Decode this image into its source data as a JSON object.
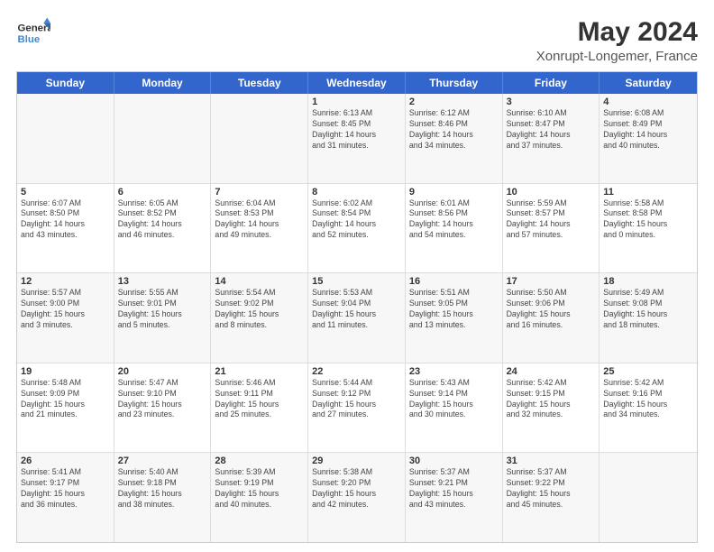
{
  "header": {
    "logo_line1": "General",
    "logo_line2": "Blue",
    "main_title": "May 2024",
    "subtitle": "Xonrupt-Longemer, France"
  },
  "days_of_week": [
    "Sunday",
    "Monday",
    "Tuesday",
    "Wednesday",
    "Thursday",
    "Friday",
    "Saturday"
  ],
  "weeks": [
    [
      {
        "day": "",
        "info": ""
      },
      {
        "day": "",
        "info": ""
      },
      {
        "day": "",
        "info": ""
      },
      {
        "day": "1",
        "info": "Sunrise: 6:13 AM\nSunset: 8:45 PM\nDaylight: 14 hours\nand 31 minutes."
      },
      {
        "day": "2",
        "info": "Sunrise: 6:12 AM\nSunset: 8:46 PM\nDaylight: 14 hours\nand 34 minutes."
      },
      {
        "day": "3",
        "info": "Sunrise: 6:10 AM\nSunset: 8:47 PM\nDaylight: 14 hours\nand 37 minutes."
      },
      {
        "day": "4",
        "info": "Sunrise: 6:08 AM\nSunset: 8:49 PM\nDaylight: 14 hours\nand 40 minutes."
      }
    ],
    [
      {
        "day": "5",
        "info": "Sunrise: 6:07 AM\nSunset: 8:50 PM\nDaylight: 14 hours\nand 43 minutes."
      },
      {
        "day": "6",
        "info": "Sunrise: 6:05 AM\nSunset: 8:52 PM\nDaylight: 14 hours\nand 46 minutes."
      },
      {
        "day": "7",
        "info": "Sunrise: 6:04 AM\nSunset: 8:53 PM\nDaylight: 14 hours\nand 49 minutes."
      },
      {
        "day": "8",
        "info": "Sunrise: 6:02 AM\nSunset: 8:54 PM\nDaylight: 14 hours\nand 52 minutes."
      },
      {
        "day": "9",
        "info": "Sunrise: 6:01 AM\nSunset: 8:56 PM\nDaylight: 14 hours\nand 54 minutes."
      },
      {
        "day": "10",
        "info": "Sunrise: 5:59 AM\nSunset: 8:57 PM\nDaylight: 14 hours\nand 57 minutes."
      },
      {
        "day": "11",
        "info": "Sunrise: 5:58 AM\nSunset: 8:58 PM\nDaylight: 15 hours\nand 0 minutes."
      }
    ],
    [
      {
        "day": "12",
        "info": "Sunrise: 5:57 AM\nSunset: 9:00 PM\nDaylight: 15 hours\nand 3 minutes."
      },
      {
        "day": "13",
        "info": "Sunrise: 5:55 AM\nSunset: 9:01 PM\nDaylight: 15 hours\nand 5 minutes."
      },
      {
        "day": "14",
        "info": "Sunrise: 5:54 AM\nSunset: 9:02 PM\nDaylight: 15 hours\nand 8 minutes."
      },
      {
        "day": "15",
        "info": "Sunrise: 5:53 AM\nSunset: 9:04 PM\nDaylight: 15 hours\nand 11 minutes."
      },
      {
        "day": "16",
        "info": "Sunrise: 5:51 AM\nSunset: 9:05 PM\nDaylight: 15 hours\nand 13 minutes."
      },
      {
        "day": "17",
        "info": "Sunrise: 5:50 AM\nSunset: 9:06 PM\nDaylight: 15 hours\nand 16 minutes."
      },
      {
        "day": "18",
        "info": "Sunrise: 5:49 AM\nSunset: 9:08 PM\nDaylight: 15 hours\nand 18 minutes."
      }
    ],
    [
      {
        "day": "19",
        "info": "Sunrise: 5:48 AM\nSunset: 9:09 PM\nDaylight: 15 hours\nand 21 minutes."
      },
      {
        "day": "20",
        "info": "Sunrise: 5:47 AM\nSunset: 9:10 PM\nDaylight: 15 hours\nand 23 minutes."
      },
      {
        "day": "21",
        "info": "Sunrise: 5:46 AM\nSunset: 9:11 PM\nDaylight: 15 hours\nand 25 minutes."
      },
      {
        "day": "22",
        "info": "Sunrise: 5:44 AM\nSunset: 9:12 PM\nDaylight: 15 hours\nand 27 minutes."
      },
      {
        "day": "23",
        "info": "Sunrise: 5:43 AM\nSunset: 9:14 PM\nDaylight: 15 hours\nand 30 minutes."
      },
      {
        "day": "24",
        "info": "Sunrise: 5:42 AM\nSunset: 9:15 PM\nDaylight: 15 hours\nand 32 minutes."
      },
      {
        "day": "25",
        "info": "Sunrise: 5:42 AM\nSunset: 9:16 PM\nDaylight: 15 hours\nand 34 minutes."
      }
    ],
    [
      {
        "day": "26",
        "info": "Sunrise: 5:41 AM\nSunset: 9:17 PM\nDaylight: 15 hours\nand 36 minutes."
      },
      {
        "day": "27",
        "info": "Sunrise: 5:40 AM\nSunset: 9:18 PM\nDaylight: 15 hours\nand 38 minutes."
      },
      {
        "day": "28",
        "info": "Sunrise: 5:39 AM\nSunset: 9:19 PM\nDaylight: 15 hours\nand 40 minutes."
      },
      {
        "day": "29",
        "info": "Sunrise: 5:38 AM\nSunset: 9:20 PM\nDaylight: 15 hours\nand 42 minutes."
      },
      {
        "day": "30",
        "info": "Sunrise: 5:37 AM\nSunset: 9:21 PM\nDaylight: 15 hours\nand 43 minutes."
      },
      {
        "day": "31",
        "info": "Sunrise: 5:37 AM\nSunset: 9:22 PM\nDaylight: 15 hours\nand 45 minutes."
      },
      {
        "day": "",
        "info": ""
      }
    ]
  ]
}
